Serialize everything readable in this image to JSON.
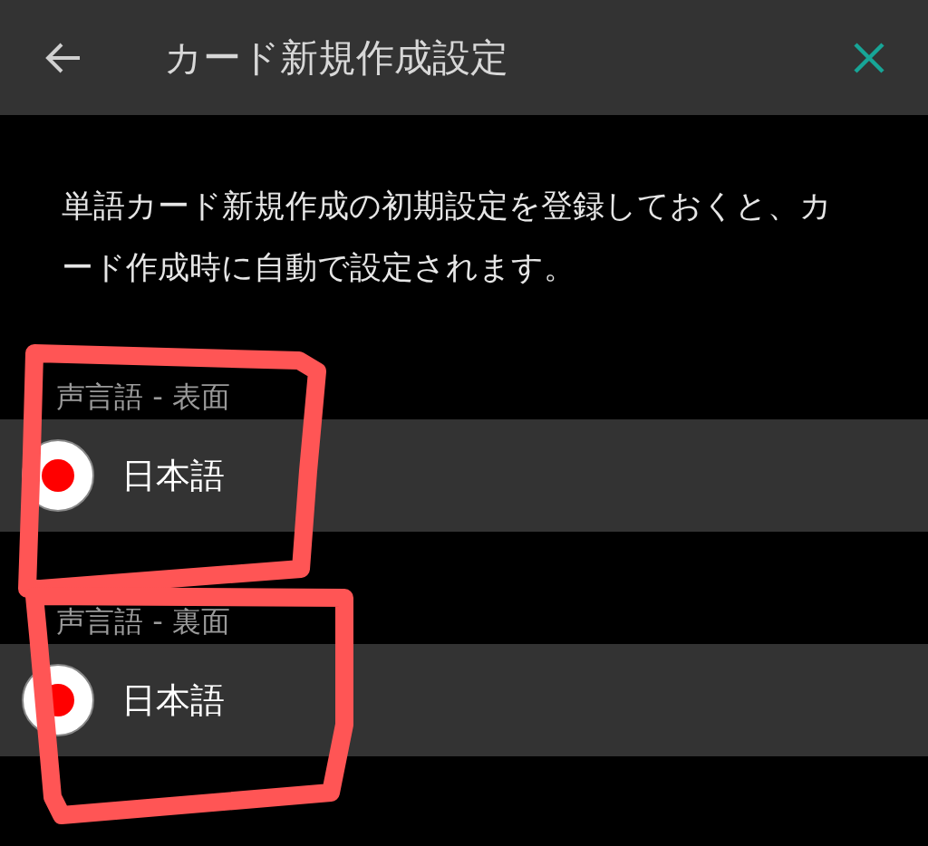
{
  "header": {
    "title": "カード新規作成設定"
  },
  "description": "単語カード新規作成の初期設定を登録しておくと、カード作成時に自動で設定されます。",
  "sections": [
    {
      "label": "声言語 - 表面",
      "options": [
        {
          "label": "日本語",
          "selected": true
        }
      ]
    },
    {
      "label": "声言語 - 裏面",
      "options": [
        {
          "label": "日本語",
          "selected": true
        }
      ]
    }
  ]
}
